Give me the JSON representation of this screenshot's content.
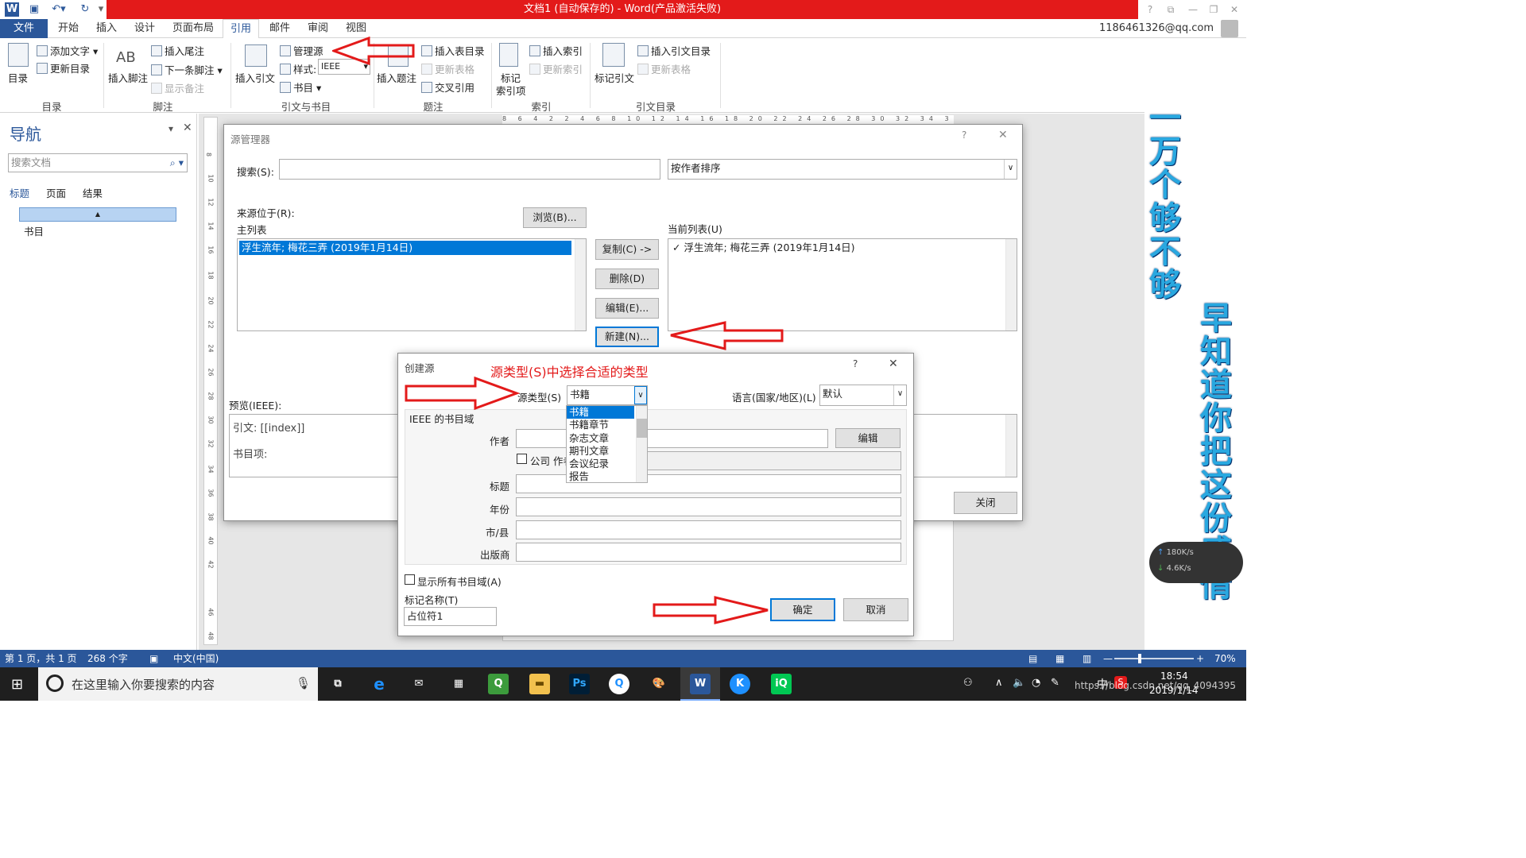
{
  "titlebar": {
    "title": "文档1 (自动保存的) - Word(产品激活失败)",
    "account": "1186461326@qq.com"
  },
  "tabs": [
    "文件",
    "开始",
    "插入",
    "设计",
    "页面布局",
    "引用",
    "邮件",
    "审阅",
    "视图"
  ],
  "ribbon": {
    "toc": {
      "toc_label": "目录",
      "add_text": "添加文字",
      "update_toc": "更新目录",
      "group": "目录"
    },
    "footnotes": {
      "insert_footnote": "插入脚注",
      "insert_endnote": "插入尾注",
      "next_footnote": "下一条脚注",
      "show_notes": "显示备注",
      "group": "脚注",
      "ab_icon": "AB"
    },
    "citations": {
      "insert_citation": "插入引文",
      "manage_sources": "管理源",
      "style_label": "样式:",
      "style_value": "IEEE",
      "bibliography": "书目",
      "group": "引文与书目"
    },
    "captions": {
      "insert_caption": "插入题注",
      "insert_table_of_figures": "插入表目录",
      "update_table": "更新表格",
      "cross_reference": "交叉引用",
      "group": "题注"
    },
    "index": {
      "mark_entry_l1": "标记",
      "mark_entry_l2": "索引项",
      "insert_index": "插入索引",
      "update_index": "更新索引",
      "group": "索引"
    },
    "authorities": {
      "mark_citation": "标记引文",
      "insert_toa": "插入引文目录",
      "update_table": "更新表格",
      "group": "引文目录"
    }
  },
  "nav": {
    "title": "导航",
    "search_placeholder": "搜索文档",
    "tabs": [
      "标题",
      "页面",
      "结果"
    ],
    "heading_item": "书目"
  },
  "ruler": {
    "numbers": [
      "8",
      "10",
      "12",
      "14",
      "16",
      "18",
      "20",
      "22",
      "24",
      "26",
      "28",
      "30",
      "32",
      "34",
      "36",
      "38",
      "40",
      "42",
      "46",
      "48"
    ],
    "top": "8 6 4 2 2 4 6 8 10 12 14 16 18 20 22 24 26 28 30 32 34 36 38 42 44 46 48"
  },
  "source_manager": {
    "title": "源管理器",
    "help": "?",
    "search_label": "搜索(S):",
    "sort_value": "按作者排序",
    "sources_in": "来源位于(R):",
    "browse": "浏览(B)...",
    "master_list": "主列表",
    "current_list": "当前列表(U)",
    "master_item": "浮生流年; 梅花三弄 (2019年1月14日)",
    "current_item": "浮生流年; 梅花三弄 (2019年1月14日)",
    "check": "✓",
    "copy": "复制(C) ->",
    "delete": "删除(D)",
    "edit": "编辑(E)...",
    "new": "新建(N)...",
    "preview_label": "预览(IEEE):",
    "citation_line": "引文:    [[index]]",
    "bib_line": "书目项:",
    "close": "关闭"
  },
  "create_source": {
    "title": "创建源",
    "help": "?",
    "annotation": "源类型(S)中选择合适的类型",
    "source_type_label": "源类型(S)",
    "source_type_value": "书籍",
    "language_label": "语言(国家/地区)(L)",
    "language_value": "默认",
    "section_label": "IEEE 的书目域",
    "author_label": "作者",
    "corporate_author": "公司 作者",
    "edit": "编辑",
    "title_label": "标题",
    "year_label": "年份",
    "city_label": "市/县",
    "publisher_label": "出版商",
    "show_all": "显示所有书目域(A)",
    "tag_label": "标记名称(T)",
    "tag_value": "占位符1",
    "ok": "确定",
    "cancel": "取消",
    "type_options": [
      "书籍",
      "书籍章节",
      "杂志文章",
      "期刊文章",
      "会议纪录",
      "报告"
    ]
  },
  "status": {
    "page": "第 1 页，共 1 页",
    "words": "268 个字",
    "lang": "中文(中国)",
    "zoom": "70%"
  },
  "taskbar": {
    "search": "在这里输入你要搜索的内容",
    "time": "18:54",
    "date": "2019/1/14",
    "url": "https://blog.csdn.net/qq_4094395",
    "ime": "中"
  },
  "banner": {
    "line1": [
      "一",
      "万",
      "个",
      "够",
      "不",
      "够"
    ],
    "line2": [
      "早",
      "知",
      "道",
      "你",
      "把",
      "这",
      "份",
      "感",
      "情"
    ]
  },
  "net_widget": {
    "up": "180K/s",
    "down": "4.6K/s"
  }
}
